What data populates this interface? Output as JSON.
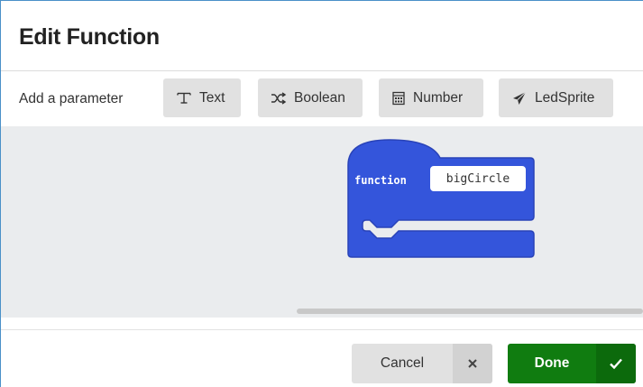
{
  "dialog": {
    "title": "Edit Function"
  },
  "parameters": {
    "label": "Add a parameter",
    "buttons": [
      {
        "label": "Text",
        "icon": "text-type-icon"
      },
      {
        "label": "Boolean",
        "icon": "shuffle-icon"
      },
      {
        "label": "Number",
        "icon": "calculator-icon"
      },
      {
        "label": "LedSprite",
        "icon": "paper-plane-icon"
      }
    ]
  },
  "block": {
    "keyword": "function",
    "name": "bigCircle",
    "color": "#3455db",
    "border_color": "#2943b8"
  },
  "footer": {
    "cancel_label": "Cancel",
    "cancel_icon": "close-icon",
    "done_label": "Done",
    "done_icon": "checkmark-icon",
    "done_color": "#107c10"
  }
}
